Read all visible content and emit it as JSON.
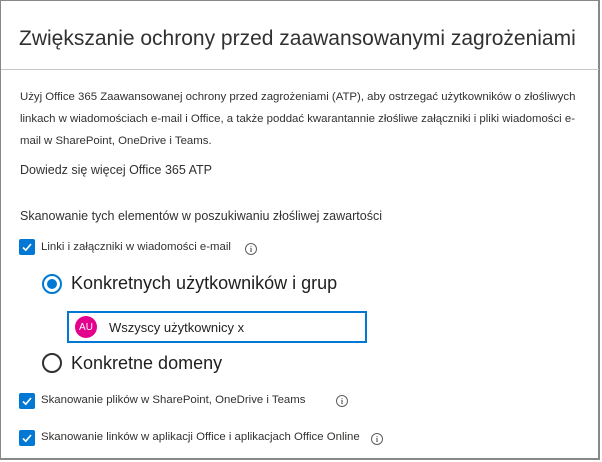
{
  "dialog": {
    "title": "Zwiększanie ochrony przed zaawansowanymi zagrożeniami",
    "description": "Użyj Office 365 Zaawansowanej ochrony przed zagrożeniami (ATP), aby ostrzegać użytkowników o złośliwych linkach w wiadomościach e-mail i Office, a także poddać kwarantannie złośliwe załączniki i pliki wiadomości e-mail w SharePoint, OneDrive i Teams.",
    "learn_more": "Dowiedz się więcej Office 365 ATP",
    "scan_heading": "Skanowanie tych elementów w poszukiwaniu złośliwej zawartości"
  },
  "options": {
    "links_attachments": {
      "label": "Linki i załączniki w wiadomości e-mail",
      "checked": true
    },
    "radio_users": {
      "label": "Konkretnych użytkowników i grup",
      "selected": true
    },
    "picker": {
      "avatar_initials": "AU",
      "value": "Wszyscy użytkownicy x",
      "avatar_color": "#e3008c"
    },
    "radio_domains": {
      "label": "Konkretne domeny",
      "selected": false
    },
    "sharepoint_scan": {
      "label": "Skanowanie plików w SharePoint, OneDrive i Teams",
      "checked": true
    },
    "office_links_scan": {
      "label": "Skanowanie linków w aplikacji Office i aplikacjach Office Online",
      "checked": true
    }
  },
  "colors": {
    "accent": "#0078d4",
    "avatar": "#e3008c"
  },
  "icons": {
    "check": "checkmark-icon",
    "info": "info-icon"
  }
}
